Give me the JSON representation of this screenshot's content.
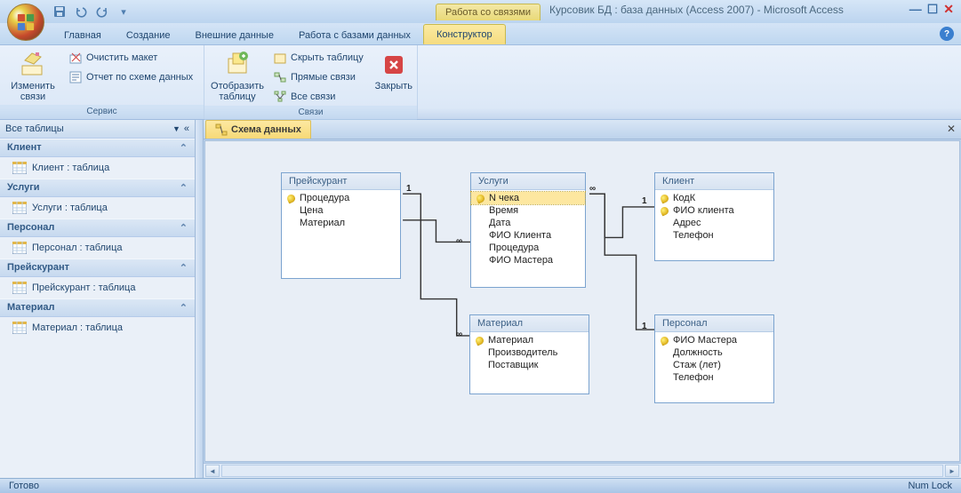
{
  "window": {
    "context_tab_label": "Работа со связями",
    "title": "Курсовик БД : база данных (Access 2007)  -  Microsoft Access"
  },
  "tabs": {
    "home": "Главная",
    "create": "Создание",
    "external": "Внешние данные",
    "dbtools": "Работа с базами данных",
    "constructor": "Конструктор"
  },
  "ribbon": {
    "group_service": "Сервис",
    "group_links": "Связи",
    "edit_links": "Изменить связи",
    "clear_layout": "Очистить макет",
    "schema_report": "Отчет по схеме данных",
    "show_table": "Отобразить таблицу",
    "hide_table": "Скрыть таблицу",
    "direct_links": "Прямые связи",
    "all_links": "Все связи",
    "close": "Закрыть"
  },
  "nav": {
    "header": "Все таблицы",
    "cats": [
      {
        "title": "Клиент",
        "item": "Клиент : таблица"
      },
      {
        "title": "Услуги",
        "item": "Услуги : таблица"
      },
      {
        "title": "Персонал",
        "item": "Персонал : таблица"
      },
      {
        "title": "Прейскурант",
        "item": "Прейскурант : таблица"
      },
      {
        "title": "Материал",
        "item": "Материал : таблица"
      }
    ]
  },
  "doc": {
    "tab": "Схема данных"
  },
  "tables": {
    "pricelist": {
      "title": "Прейскурант",
      "fields": [
        "Процедура",
        "Цена",
        "Материал"
      ]
    },
    "services": {
      "title": "Услуги",
      "fields": [
        "N чека",
        "Время",
        "Дата",
        "ФИО Клиента",
        "Процедура",
        "ФИО Мастера"
      ]
    },
    "client": {
      "title": "Клиент",
      "fields": [
        "КодК",
        "ФИО клиента",
        "Адрес",
        "Телефон"
      ]
    },
    "material": {
      "title": "Материал",
      "fields": [
        "Материал",
        "Производитель",
        "Поставщик"
      ]
    },
    "staff": {
      "title": "Персонал",
      "fields": [
        "ФИО Мастера",
        "Должность",
        "Стаж (лет)",
        "Телефон"
      ]
    }
  },
  "status": {
    "left": "Готово",
    "right": "Num Lock"
  }
}
